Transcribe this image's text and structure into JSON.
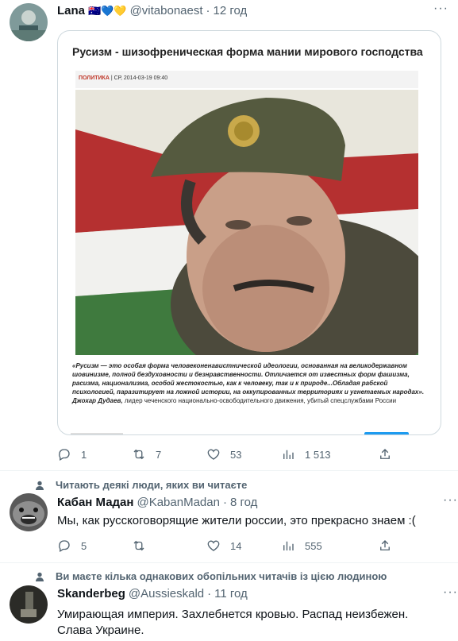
{
  "tweet1": {
    "name": "Lana",
    "flags": "🇦🇺💙💛",
    "handle": "@vitabonaest",
    "time": "12 год",
    "article": {
      "title": "Русизм - шизофреническая форма мании мирового господства",
      "category": "ПОЛИТИКА",
      "date": "| СР, 2014-03-19 09:40",
      "quote": "«Русизм — это особая форма человеконенавистнической идеологии, основанная на великодержавном шовинизме, полной бездуховности и безнравственности. Отличается от известных форм фашизма, расизма, национализма, особой жестокостью, как к человеку, так и к природе...Обладая рабской психологией, паразитирует на ложной истории, на оккупированных территориях и угнетаемых народах».",
      "author": "Джохар Дудаев,",
      "author_desc": "лидер чеченского национально-освободительного движения, убитый спецслужбами России"
    },
    "replies": "1",
    "retweets": "7",
    "likes": "53",
    "views": "1 513"
  },
  "tweet2": {
    "context": "Читають деякі люди, яких ви читаєте",
    "name": "Кабан Мадан",
    "handle": "@KabanMadan",
    "time": "8 год",
    "text": "Мы, как русскоговорящие жители россии, это прекрасно знаем :(",
    "replies": "5",
    "retweets": "",
    "likes": "14",
    "views": "555"
  },
  "tweet3": {
    "context": "Ви маєте кілька однакових обопільних читачів із цією людиною",
    "name": "Skanderbeg",
    "handle": "@Aussieskald",
    "time": "11 год",
    "text": "Умирающая империя. Захлебнется кровью. Распад неизбежен. Слава Украине."
  },
  "common": {
    "dot": "·",
    "more": "···"
  },
  "colors": {
    "text": "#0f1419",
    "muted": "#536471",
    "accent": "#1d9bf0",
    "border": "#cfd9de"
  }
}
